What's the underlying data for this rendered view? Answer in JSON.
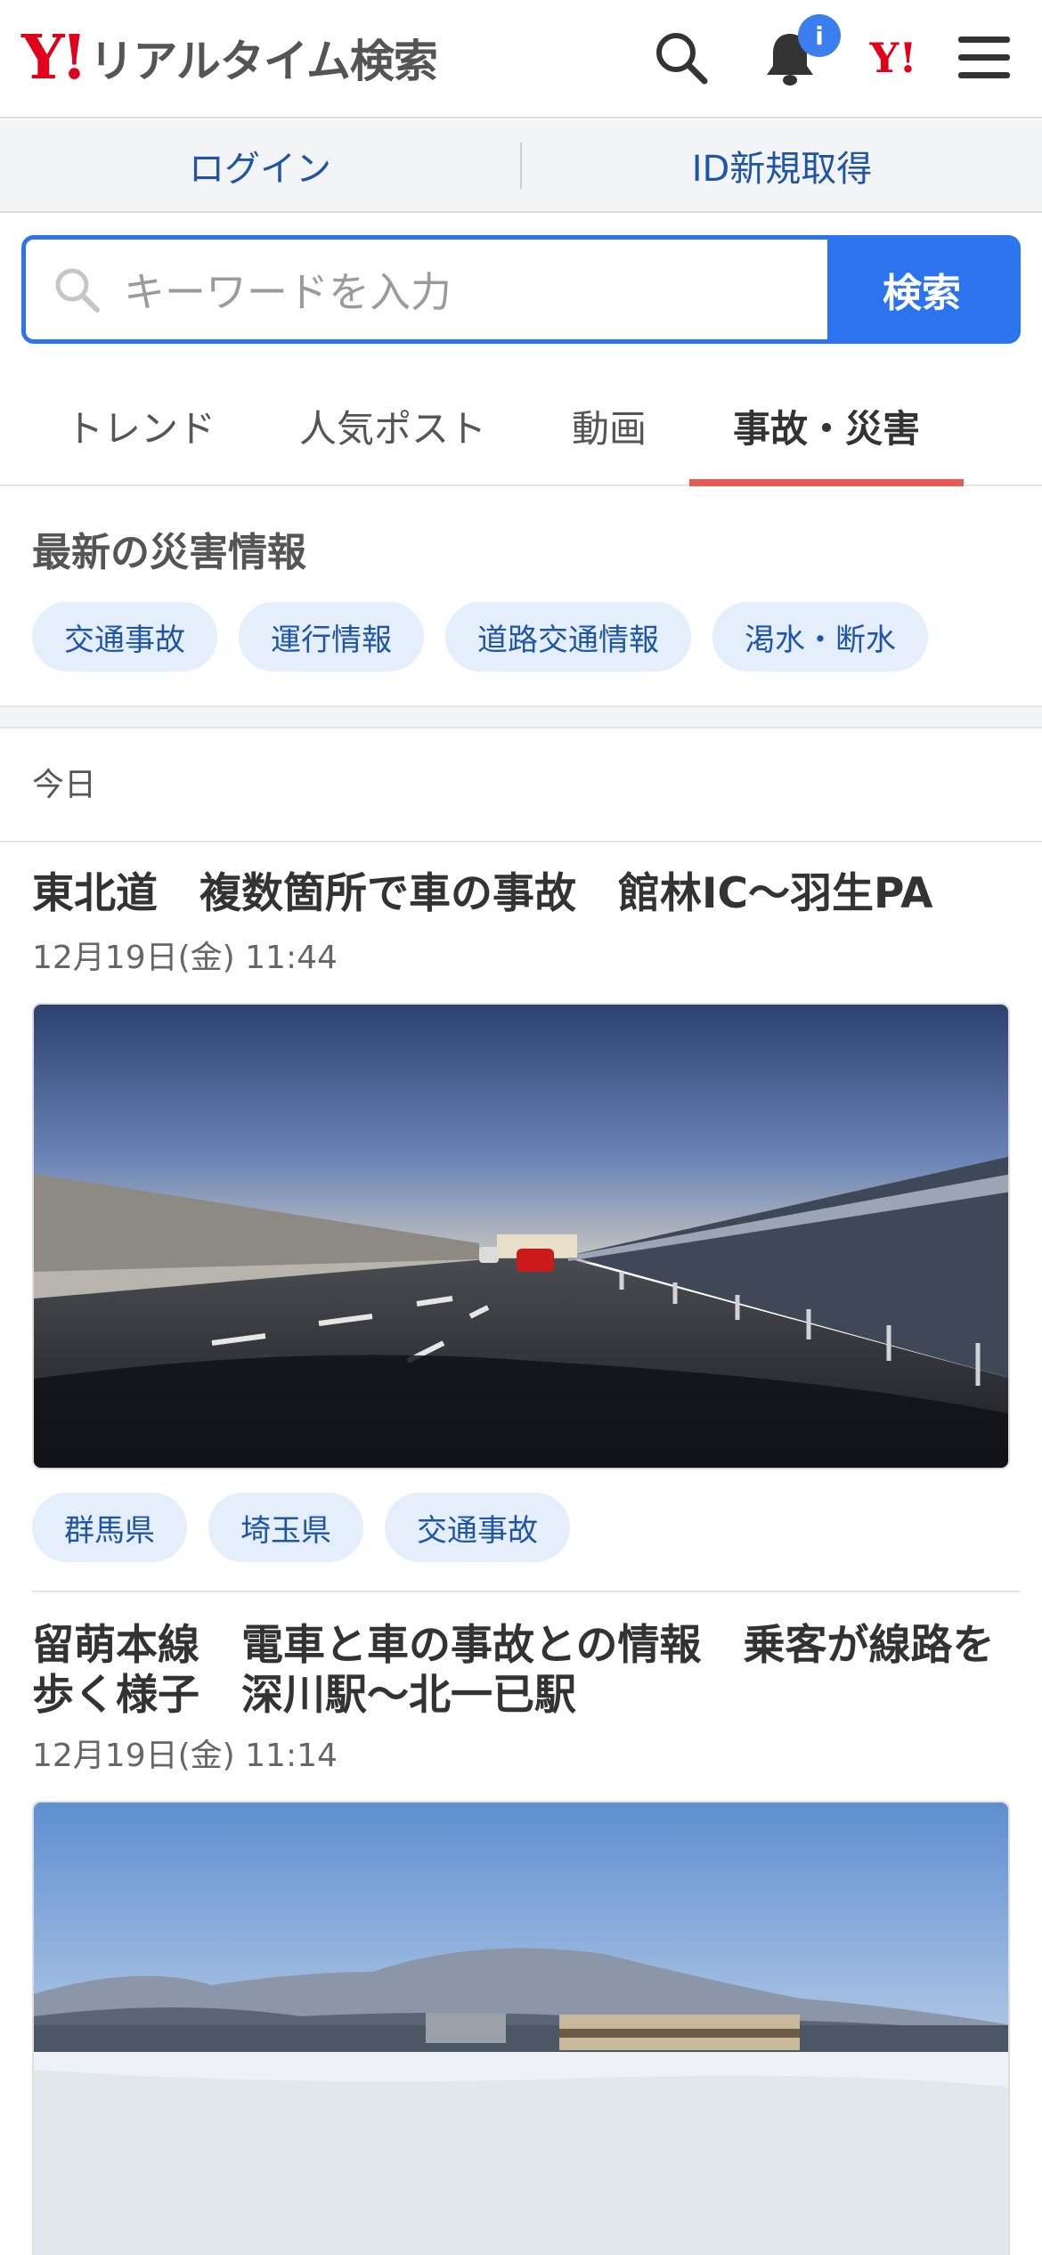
{
  "header": {
    "logo_mark": "Y!",
    "logo_text": "リアルタイム検索",
    "notification_badge": "i",
    "yahoo_mark": "Y!"
  },
  "account": {
    "login_label": "ログイン",
    "signup_label": "ID新規取得"
  },
  "search": {
    "placeholder": "キーワードを入力",
    "button_label": "検索"
  },
  "tabs": [
    {
      "label": "トレンド",
      "active": false
    },
    {
      "label": "人気ポスト",
      "active": false
    },
    {
      "label": "動画",
      "active": false
    },
    {
      "label": "事故・災害",
      "active": true
    }
  ],
  "disaster": {
    "title": "最新の災害情報",
    "chips": [
      "交通事故",
      "運行情報",
      "道路交通情報",
      "渇水・断水"
    ]
  },
  "timeline": {
    "day_label": "今日"
  },
  "articles": [
    {
      "title": "東北道　複数箇所で車の事故　館林IC〜羽生PA",
      "date": "12月19日(金) 11:44",
      "image": "highway-dashcam-photo",
      "tags": [
        "群馬県",
        "埼玉県",
        "交通事故"
      ]
    },
    {
      "title": "留萌本線　電車と車の事故との情報　乗客が線路を歩く様子　深川駅〜北一已駅",
      "date": "12月19日(金) 11:14",
      "image": "snowy-train-photo",
      "tags": []
    }
  ],
  "colors": {
    "brand_red": "#e2001a",
    "accent_blue": "#2b74ee",
    "link_blue": "#1f55a8",
    "chip_bg": "#e5eefb",
    "tab_underline": "#e65a52"
  }
}
